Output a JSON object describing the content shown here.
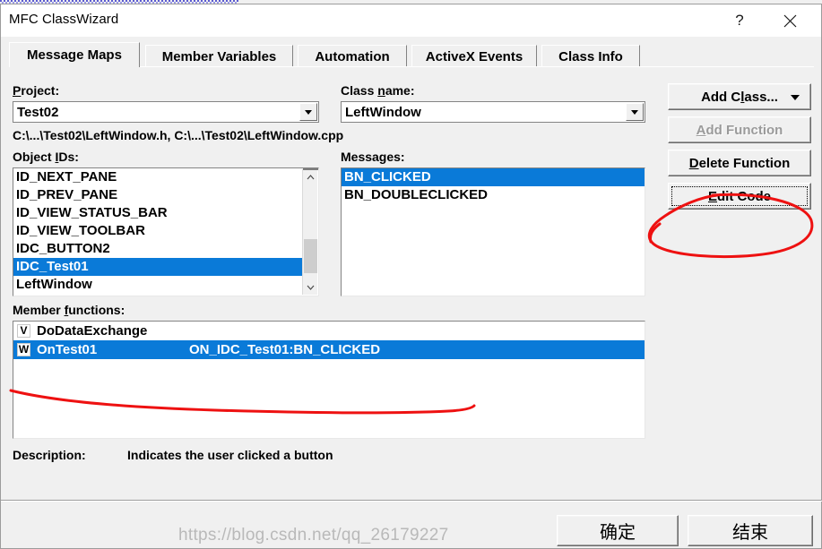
{
  "window": {
    "title": "MFC ClassWizard",
    "help_label": "?",
    "close_label": "close-icon"
  },
  "tabs": [
    {
      "label": "Message Maps",
      "selected": true
    },
    {
      "label": "Member Variables",
      "selected": false
    },
    {
      "label": "Automation",
      "selected": false
    },
    {
      "label": "ActiveX Events",
      "selected": false
    },
    {
      "label": "Class Info",
      "selected": false
    }
  ],
  "fields": {
    "project_label": "Project:",
    "project_label_accel": "P",
    "project_value": "Test02",
    "class_name_label": "Class name:",
    "class_name_accel": "n",
    "class_name_value": "LeftWindow",
    "file_path": "C:\\...\\Test02\\LeftWindow.h, C:\\...\\Test02\\LeftWindow.cpp"
  },
  "object_ids": {
    "label": "Object IDs:",
    "label_accel": "I",
    "items": [
      {
        "text": "ID_NEXT_PANE",
        "selected": false
      },
      {
        "text": "ID_PREV_PANE",
        "selected": false
      },
      {
        "text": "ID_VIEW_STATUS_BAR",
        "selected": false
      },
      {
        "text": "ID_VIEW_TOOLBAR",
        "selected": false
      },
      {
        "text": "IDC_BUTTON2",
        "selected": false
      },
      {
        "text": "IDC_Test01",
        "selected": true
      },
      {
        "text": "LeftWindow",
        "selected": false
      }
    ]
  },
  "messages": {
    "label": "Messages:",
    "items": [
      {
        "text": "BN_CLICKED",
        "selected": true
      },
      {
        "text": "BN_DOUBLECLICKED",
        "selected": false
      }
    ]
  },
  "member_functions": {
    "label": "Member functions:",
    "label_accel": "f",
    "items": [
      {
        "icon": "V",
        "name": "DoDataExchange",
        "message": "",
        "selected": false
      },
      {
        "icon": "W",
        "name": "OnTest01",
        "message": "ON_IDC_Test01:BN_CLICKED",
        "selected": true
      }
    ]
  },
  "description": {
    "label": "Description:",
    "value": "Indicates the user clicked a button"
  },
  "side_buttons": [
    {
      "label": "Add Class...",
      "accel": "l",
      "disabled": false,
      "dropdown": true,
      "focused": false
    },
    {
      "label": "Add Function",
      "accel": "A",
      "disabled": true,
      "dropdown": false,
      "focused": false
    },
    {
      "label": "Delete Function",
      "accel": "D",
      "disabled": false,
      "dropdown": false,
      "focused": false
    },
    {
      "label": "Edit Code",
      "accel": "E",
      "disabled": false,
      "dropdown": false,
      "focused": true
    }
  ],
  "bottom_buttons": [
    {
      "label": "确定"
    },
    {
      "label": "结束"
    }
  ],
  "watermark": "https://blog.csdn.net/qq_26179227",
  "colors": {
    "selection_blue": "#0a7ad8",
    "annotation_red": "#ee1111",
    "dialog_face": "#f0f0f0",
    "field_bg": "#ffffff"
  }
}
